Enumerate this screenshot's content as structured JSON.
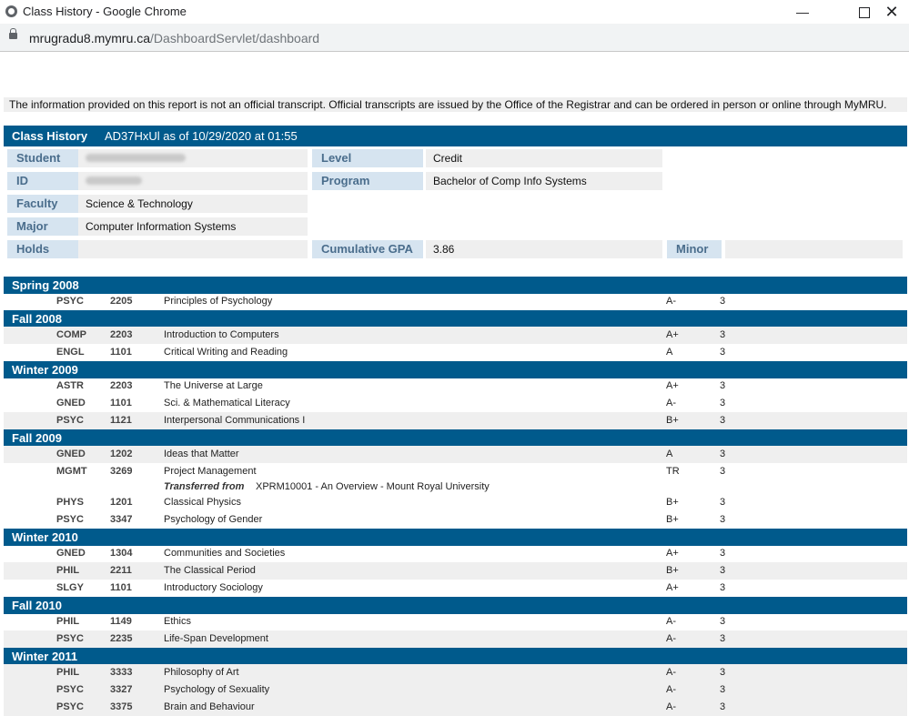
{
  "window": {
    "title": "Class History - Google Chrome",
    "url_host": "mrugradu8.mymru.ca",
    "url_path": "/DashboardServlet/dashboard"
  },
  "disclaimer": "The information provided on this report is not an official transcript. Official transcripts are issued by the Office of the Registrar and can be ordered in person or online through MyMRU.",
  "header": {
    "title": "Class History",
    "as_of": "AD37HxUl as of 10/29/2020 at 01:55"
  },
  "info": {
    "student_label": "Student",
    "id_label": "ID",
    "faculty_label": "Faculty",
    "faculty": "Science & Technology",
    "major_label": "Major",
    "major": "Computer Information Systems",
    "holds_label": "Holds",
    "holds": "",
    "level_label": "Level",
    "level": "Credit",
    "program_label": "Program",
    "program": "Bachelor of Comp Info Systems",
    "gpa_label": "Cumulative GPA",
    "gpa": "3.86",
    "minor_label": "Minor",
    "minor": ""
  },
  "terms": [
    {
      "name": "Spring 2008",
      "courses": [
        {
          "subject": "PSYC",
          "number": "2205",
          "title": "Principles of Psychology",
          "grade": "A-",
          "credits": "3"
        }
      ]
    },
    {
      "name": "Fall 2008",
      "courses": [
        {
          "subject": "COMP",
          "number": "2203",
          "title": "Introduction to Computers",
          "grade": "A+",
          "credits": "3"
        },
        {
          "subject": "ENGL",
          "number": "1101",
          "title": "Critical Writing and Reading",
          "grade": "A",
          "credits": "3"
        }
      ]
    },
    {
      "name": "Winter 2009",
      "courses": [
        {
          "subject": "ASTR",
          "number": "2203",
          "title": "The Universe at Large",
          "grade": "A+",
          "credits": "3"
        },
        {
          "subject": "GNED",
          "number": "1101",
          "title": "Sci. & Mathematical Literacy",
          "grade": "A-",
          "credits": "3"
        },
        {
          "subject": "PSYC",
          "number": "1121",
          "title": "Interpersonal Communications I",
          "grade": "B+",
          "credits": "3"
        }
      ]
    },
    {
      "name": "Fall 2009",
      "courses": [
        {
          "subject": "GNED",
          "number": "1202",
          "title": "Ideas that Matter",
          "grade": "A",
          "credits": "3"
        },
        {
          "subject": "MGMT",
          "number": "3269",
          "title": "Project Management",
          "grade": "TR",
          "credits": "3",
          "transfer_label": "Transferred from",
          "transfer_from": "XPRM10001 - An Overview - Mount Royal University"
        },
        {
          "subject": "PHYS",
          "number": "1201",
          "title": "Classical Physics",
          "grade": "B+",
          "credits": "3"
        },
        {
          "subject": "PSYC",
          "number": "3347",
          "title": "Psychology of Gender",
          "grade": "B+",
          "credits": "3"
        }
      ]
    },
    {
      "name": "Winter 2010",
      "courses": [
        {
          "subject": "GNED",
          "number": "1304",
          "title": "Communities and Societies",
          "grade": "A+",
          "credits": "3"
        },
        {
          "subject": "PHIL",
          "number": "2211",
          "title": "The Classical Period",
          "grade": "B+",
          "credits": "3"
        },
        {
          "subject": "SLGY",
          "number": "1101",
          "title": "Introductory Sociology",
          "grade": "A+",
          "credits": "3"
        }
      ]
    },
    {
      "name": "Fall 2010",
      "courses": [
        {
          "subject": "PHIL",
          "number": "1149",
          "title": "Ethics",
          "grade": "A-",
          "credits": "3"
        },
        {
          "subject": "PSYC",
          "number": "2235",
          "title": "Life-Span Development",
          "grade": "A-",
          "credits": "3"
        }
      ]
    },
    {
      "name": "Winter 2011",
      "courses": [
        {
          "subject": "PHIL",
          "number": "3333",
          "title": "Philosophy of Art",
          "grade": "A-",
          "credits": "3"
        },
        {
          "subject": "PSYC",
          "number": "3327",
          "title": "Psychology of Sexuality",
          "grade": "A-",
          "credits": "3"
        },
        {
          "subject": "PSYC",
          "number": "3375",
          "title": "Brain and Behaviour",
          "grade": "A-",
          "credits": "3"
        }
      ]
    }
  ]
}
